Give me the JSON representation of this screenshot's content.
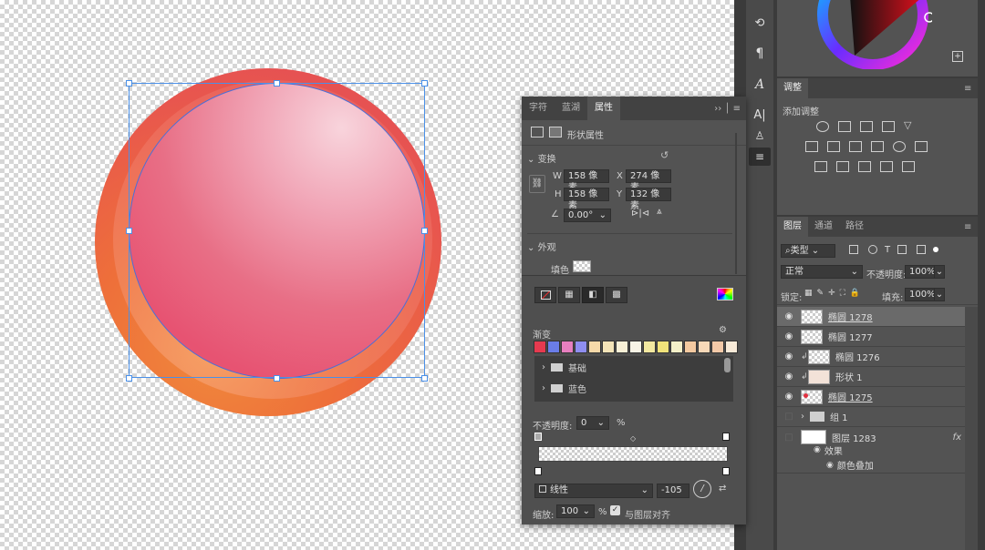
{
  "properties_panel": {
    "tabs": [
      "字符",
      "蓝湖",
      "属性"
    ],
    "section_title": "形状属性",
    "transform": {
      "label": "变换",
      "w_label": "W",
      "w_value": "158 像素",
      "h_label": "H",
      "h_value": "158 像素",
      "x_label": "X",
      "x_value": "274 像素",
      "y_label": "Y",
      "y_value": "132 像素",
      "angle_value": "0.00°"
    },
    "appearance": {
      "label": "外观",
      "fill_label": "填色"
    }
  },
  "gradient_panel": {
    "title": "渐变",
    "folders": [
      "基础",
      "蓝色"
    ],
    "opacity_label": "不透明度:",
    "opacity_value": "0",
    "opacity_unit": "%",
    "type_value": "线性",
    "angle_value": "-105",
    "scale_label": "缩放:",
    "scale_value": "100",
    "scale_unit": "%",
    "align_label": "与图层对齐",
    "swatch_colors": [
      "#e63a4f",
      "#6a7de8",
      "#e77fbf",
      "#8f8ef0",
      "#f6d9a9",
      "#f4e4b8",
      "#f8f0d6",
      "#f8f4e6",
      "#f2e8a0",
      "#f0e27a",
      "#f4f0c8",
      "#f3c9a0",
      "#f7d8b8",
      "#f3c9a8",
      "#f8ead8"
    ]
  },
  "adjustments_panel": {
    "tab": "调整",
    "add_label": "添加调整"
  },
  "layers_panel": {
    "tabs": [
      "图层",
      "通道",
      "路径"
    ],
    "filter_label": "类型",
    "blend_mode": "正常",
    "opacity_label": "不透明度:",
    "opacity_value": "100%",
    "lock_label": "锁定:",
    "fill_label": "填充:",
    "fill_value": "100%",
    "layers": [
      {
        "name": "椭圆 1278",
        "visible": true,
        "selected": true
      },
      {
        "name": "椭圆 1277",
        "visible": true
      },
      {
        "name": "椭圆 1276",
        "visible": true,
        "clipped": true
      },
      {
        "name": "形状 1",
        "visible": true,
        "clipped": true
      },
      {
        "name": "椭圆 1275",
        "visible": true
      },
      {
        "name": "组 1",
        "visible": false,
        "group": true
      },
      {
        "name": "图层 1283",
        "visible": false,
        "fx": "fx"
      },
      {
        "name": "效果",
        "sub": true
      },
      {
        "name": "颜色叠加",
        "sub": true
      }
    ]
  },
  "colors": {
    "panel_bg": "#535353",
    "dark_bg": "#3c3c3c",
    "selection_blue": "#4a90e8",
    "circle_pink": "#e75372",
    "circle_orange": "#ee6f3a"
  }
}
